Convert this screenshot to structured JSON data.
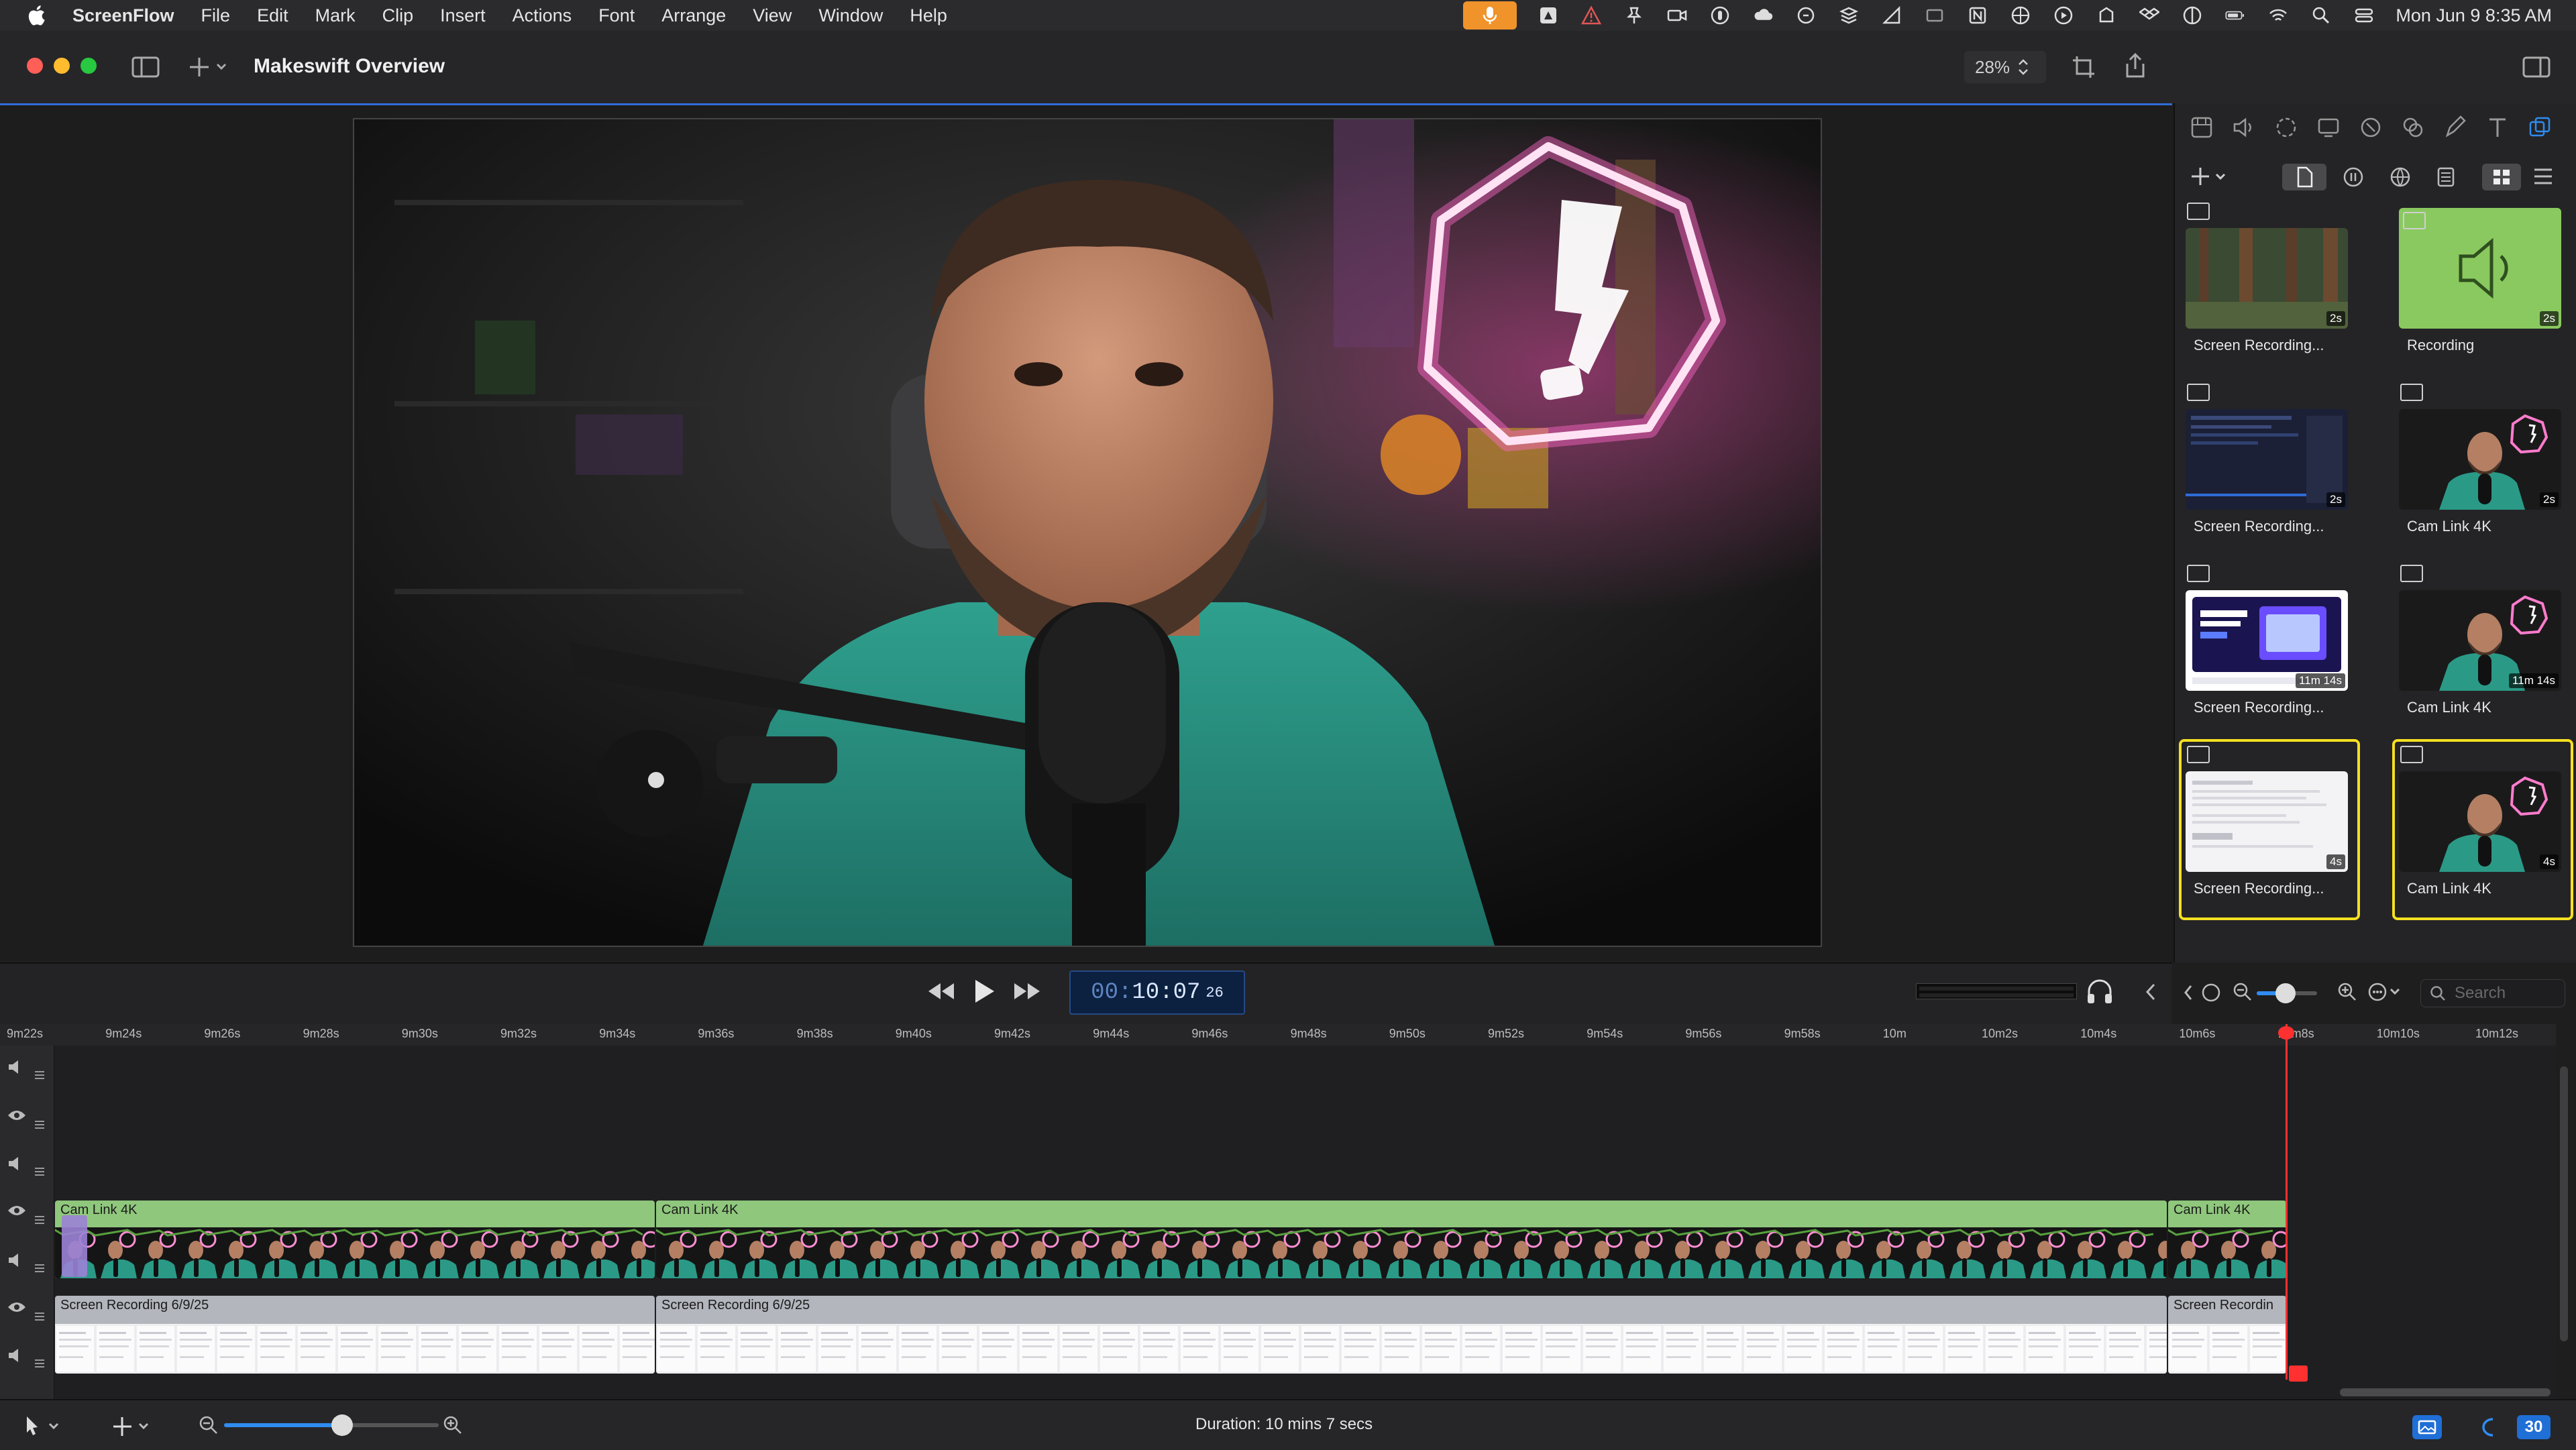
{
  "menubar": {
    "app_name": "ScreenFlow",
    "items": [
      "File",
      "Edit",
      "Mark",
      "Clip",
      "Insert",
      "Actions",
      "Font",
      "Arrange",
      "View",
      "Window",
      "Help"
    ],
    "clock": "Mon Jun 9  8:35 AM"
  },
  "window": {
    "title": "Makeswift Overview",
    "zoom": "28%"
  },
  "media_library": {
    "tiles": [
      {
        "label": "Screen Recording...",
        "duration": "2s",
        "selected": false,
        "kind": "forest"
      },
      {
        "label": "Recording",
        "duration": "2s",
        "selected": false,
        "kind": "audio"
      },
      {
        "label": "Screen Recording...",
        "duration": "2s",
        "selected": false,
        "kind": "code"
      },
      {
        "label": "Cam Link 4K",
        "duration": "2s",
        "selected": false,
        "kind": "cam"
      },
      {
        "label": "Screen Recording...",
        "duration": "11m 14s",
        "selected": false,
        "kind": "web"
      },
      {
        "label": "Cam Link 4K",
        "duration": "11m 14s",
        "selected": false,
        "kind": "cam"
      },
      {
        "label": "Screen Recording...",
        "duration": "4s",
        "selected": true,
        "kind": "doc"
      },
      {
        "label": "Cam Link 4K",
        "duration": "4s",
        "selected": true,
        "kind": "cam"
      }
    ],
    "search_placeholder": "Search"
  },
  "transport": {
    "timecode_dim": "00:",
    "timecode_main": "10:07",
    "timecode_frames": "26"
  },
  "timeline": {
    "ruler_ticks": [
      "9m22s",
      "9m24s",
      "9m26s",
      "9m28s",
      "9m30s",
      "9m32s",
      "9m34s",
      "9m36s",
      "9m38s",
      "9m40s",
      "9m42s",
      "9m44s",
      "9m46s",
      "9m48s",
      "9m50s",
      "9m52s",
      "9m54s",
      "9m56s",
      "9m58s",
      "10m",
      "10m2s",
      "10m4s",
      "10m6s",
      "10m8s",
      "10m10s",
      "10m12s"
    ],
    "cam_clips": [
      "Cam Link 4K",
      "Cam Link 4K",
      "Cam Link 4K"
    ],
    "screen_clips": [
      "Screen Recording 6/9/25",
      "Screen Recording 6/9/25",
      "Screen Recordin"
    ],
    "duration": "Duration: 10 mins 7 secs"
  },
  "bottom": {
    "badge": "30"
  },
  "colors": {
    "accent": "#2f6bd6",
    "selection": "#f5e020",
    "playhead": "#ff3030",
    "cam_clip": "#8fc77c",
    "screen_clip": "#b3b6bd",
    "record": "#f0932b"
  }
}
